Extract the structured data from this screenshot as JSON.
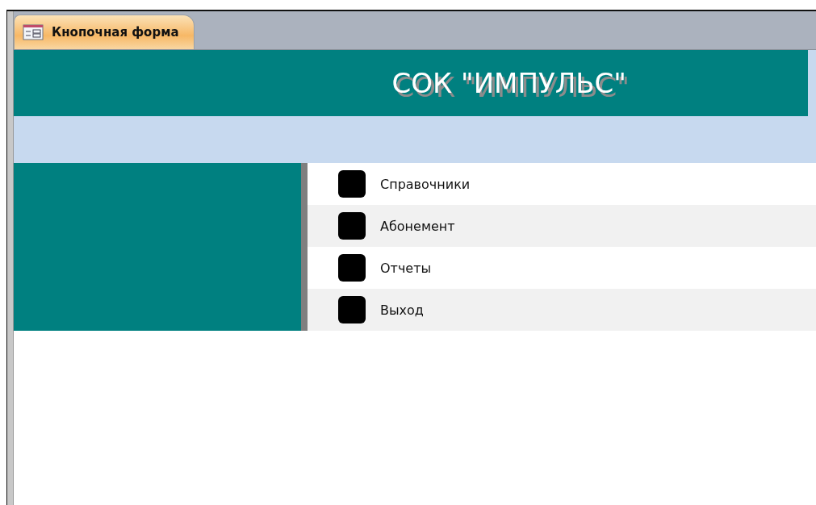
{
  "tabs": [
    {
      "label": "Кнопочная форма",
      "selected": true
    }
  ],
  "header": {
    "title": "СОК \"ИМПУЛЬС\""
  },
  "items": [
    {
      "label": "Справочники"
    },
    {
      "label": "Абонемент"
    },
    {
      "label": "Отчеты"
    },
    {
      "label": "Выход"
    }
  ]
}
